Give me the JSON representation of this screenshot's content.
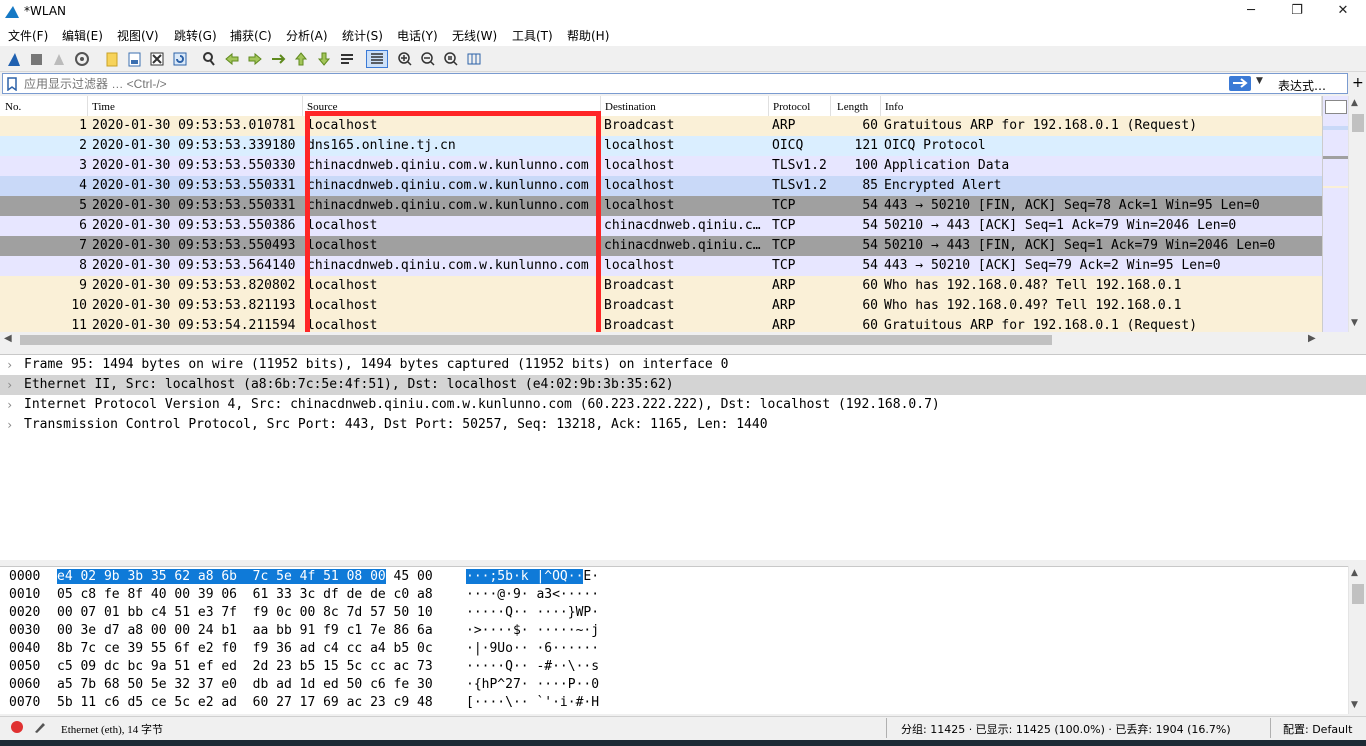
{
  "window": {
    "title": "*WLAN"
  },
  "menu": [
    "文件(F)",
    "编辑(E)",
    "视图(V)",
    "跳转(G)",
    "捕获(C)",
    "分析(A)",
    "统计(S)",
    "电话(Y)",
    "无线(W)",
    "工具(T)",
    "帮助(H)"
  ],
  "toolbar_icons": [
    "shark-fin-start-icon",
    "stop-icon",
    "restart-icon",
    "options-gear-icon",
    "open-file-icon",
    "save-file-icon",
    "close-file-icon",
    "reload-icon",
    "find-icon",
    "go-back-icon",
    "go-forward-icon",
    "go-to-packet-icon",
    "first-packet-icon",
    "last-packet-icon",
    "autoscroll-icon",
    "colorize-icon",
    "zoom-in-icon",
    "zoom-out-icon",
    "zoom-normal-icon",
    "resize-columns-icon"
  ],
  "filter": {
    "placeholder": "应用显示过滤器 … <Ctrl-/>",
    "expression_label": "表达式…",
    "plus": "+"
  },
  "columns": {
    "no": "No.",
    "time": "Time",
    "source": "Source",
    "destination": "Destination",
    "protocol": "Protocol",
    "length": "Length",
    "info": "Info"
  },
  "packets": [
    {
      "no": "1",
      "time": "2020-01-30 09:53:53.010781",
      "source": "localhost",
      "destination": "Broadcast",
      "protocol": "ARP",
      "length": "60",
      "info": "Gratuitous ARP for 192.168.0.1 (Request)",
      "bg": "#faf0d7"
    },
    {
      "no": "2",
      "time": "2020-01-30 09:53:53.339180",
      "source": "dns165.online.tj.cn",
      "destination": "localhost",
      "protocol": "OICQ",
      "length": "121",
      "info": "OICQ Protocol",
      "bg": "#daeeff"
    },
    {
      "no": "3",
      "time": "2020-01-30 09:53:53.550330",
      "source": "chinacdnweb.qiniu.com.w.kunlunno.com",
      "destination": "localhost",
      "protocol": "TLSv1.2",
      "length": "100",
      "info": "Application Data",
      "bg": "#e7e6ff"
    },
    {
      "no": "4",
      "time": "2020-01-30 09:53:53.550331",
      "source": "chinacdnweb.qiniu.com.w.kunlunno.com",
      "destination": "localhost",
      "protocol": "TLSv1.2",
      "length": "85",
      "info": "Encrypted Alert",
      "bg": "#c9d9f8"
    },
    {
      "no": "5",
      "time": "2020-01-30 09:53:53.550331",
      "source": "chinacdnweb.qiniu.com.w.kunlunno.com",
      "destination": "localhost",
      "protocol": "TCP",
      "length": "54",
      "info": "443 → 50210 [FIN, ACK] Seq=78 Ack=1 Win=95 Len=0",
      "bg": "#a0a0a0"
    },
    {
      "no": "6",
      "time": "2020-01-30 09:53:53.550386",
      "source": "localhost",
      "destination": "chinacdnweb.qiniu.c…",
      "protocol": "TCP",
      "length": "54",
      "info": "50210 → 443 [ACK] Seq=1 Ack=79 Win=2046 Len=0",
      "bg": "#e7e6ff"
    },
    {
      "no": "7",
      "time": "2020-01-30 09:53:53.550493",
      "source": "localhost",
      "destination": "chinacdnweb.qiniu.c…",
      "protocol": "TCP",
      "length": "54",
      "info": "50210 → 443 [FIN, ACK] Seq=1 Ack=79 Win=2046 Len=0",
      "bg": "#a0a0a0"
    },
    {
      "no": "8",
      "time": "2020-01-30 09:53:53.564140",
      "source": "chinacdnweb.qiniu.com.w.kunlunno.com",
      "destination": "localhost",
      "protocol": "TCP",
      "length": "54",
      "info": "443 → 50210 [ACK] Seq=79 Ack=2 Win=95 Len=0",
      "bg": "#e7e6ff"
    },
    {
      "no": "9",
      "time": "2020-01-30 09:53:53.820802",
      "source": "localhost",
      "destination": "Broadcast",
      "protocol": "ARP",
      "length": "60",
      "info": "Who has 192.168.0.48? Tell 192.168.0.1",
      "bg": "#faf0d7"
    },
    {
      "no": "10",
      "time": "2020-01-30 09:53:53.821193",
      "source": "localhost",
      "destination": "Broadcast",
      "protocol": "ARP",
      "length": "60",
      "info": "Who has 192.168.0.49? Tell 192.168.0.1",
      "bg": "#faf0d7"
    },
    {
      "no": "11",
      "time": "2020-01-30 09:53:54.211594",
      "source": "localhost",
      "destination": "Broadcast",
      "protocol": "ARP",
      "length": "60",
      "info": "Gratuitous ARP for 192.168.0.1 (Request)",
      "bg": "#faf0d7"
    }
  ],
  "details": [
    {
      "text": "Frame 95: 1494 bytes on wire (11952 bits), 1494 bytes captured (11952 bits) on interface 0",
      "selected": false
    },
    {
      "text": "Ethernet II, Src: localhost (a8:6b:7c:5e:4f:51), Dst: localhost (e4:02:9b:3b:35:62)",
      "selected": true
    },
    {
      "text": "Internet Protocol Version 4, Src: chinacdnweb.qiniu.com.w.kunlunno.com (60.223.222.222), Dst: localhost (192.168.0.7)",
      "selected": false
    },
    {
      "text": "Transmission Control Protocol, Src Port: 443, Dst Port: 50257, Seq: 13218, Ack: 1165, Len: 1440",
      "selected": false
    }
  ],
  "bytes": [
    {
      "offset": "0000",
      "hex_hl": "e4 02 9b 3b 35 62 a8 6b  7c 5e 4f 51 08 00",
      "hex_rest": " 45 00",
      "ascii_hl": "···;5b·k |^OQ··",
      "ascii_rest": "E·"
    },
    {
      "offset": "0010",
      "hex_hl": "",
      "hex_rest": "05 c8 fe 8f 40 00 39 06  61 33 3c df de de c0 a8",
      "ascii_hl": "",
      "ascii_rest": "····@·9· a3<·····"
    },
    {
      "offset": "0020",
      "hex_hl": "",
      "hex_rest": "00 07 01 bb c4 51 e3 7f  f9 0c 00 8c 7d 57 50 10",
      "ascii_hl": "",
      "ascii_rest": "·····Q·· ····}WP·"
    },
    {
      "offset": "0030",
      "hex_hl": "",
      "hex_rest": "00 3e d7 a8 00 00 24 b1  aa bb 91 f9 c1 7e 86 6a",
      "ascii_hl": "",
      "ascii_rest": "·>····$· ·····~·j"
    },
    {
      "offset": "0040",
      "hex_hl": "",
      "hex_rest": "8b 7c ce 39 55 6f e2 f0  f9 36 ad c4 cc a4 b5 0c",
      "ascii_hl": "",
      "ascii_rest": "·|·9Uo·· ·6······"
    },
    {
      "offset": "0050",
      "hex_hl": "",
      "hex_rest": "c5 09 dc bc 9a 51 ef ed  2d 23 b5 15 5c cc ac 73",
      "ascii_hl": "",
      "ascii_rest": "·····Q·· -#··\\··s"
    },
    {
      "offset": "0060",
      "hex_hl": "",
      "hex_rest": "a5 7b 68 50 5e 32 37 e0  db ad 1d ed 50 c6 fe 30",
      "ascii_hl": "",
      "ascii_rest": "·{hP^27· ····P··0"
    },
    {
      "offset": "0070",
      "hex_hl": "",
      "hex_rest": "5b 11 c6 d5 ce 5c e2 ad  60 27 17 69 ac 23 c9 48",
      "ascii_hl": "",
      "ascii_rest": "[····\\·· `'·i·#·H"
    }
  ],
  "status": {
    "field": "Ethernet (eth), 14 字节",
    "stats": "分组: 11425 · 已显示: 11425 (100.0%) · 已丢弃: 1904 (16.7%)",
    "profile": "配置: Default"
  },
  "colors": {
    "selection": "#0f7ad8",
    "highlight_box": "#ff2626"
  }
}
